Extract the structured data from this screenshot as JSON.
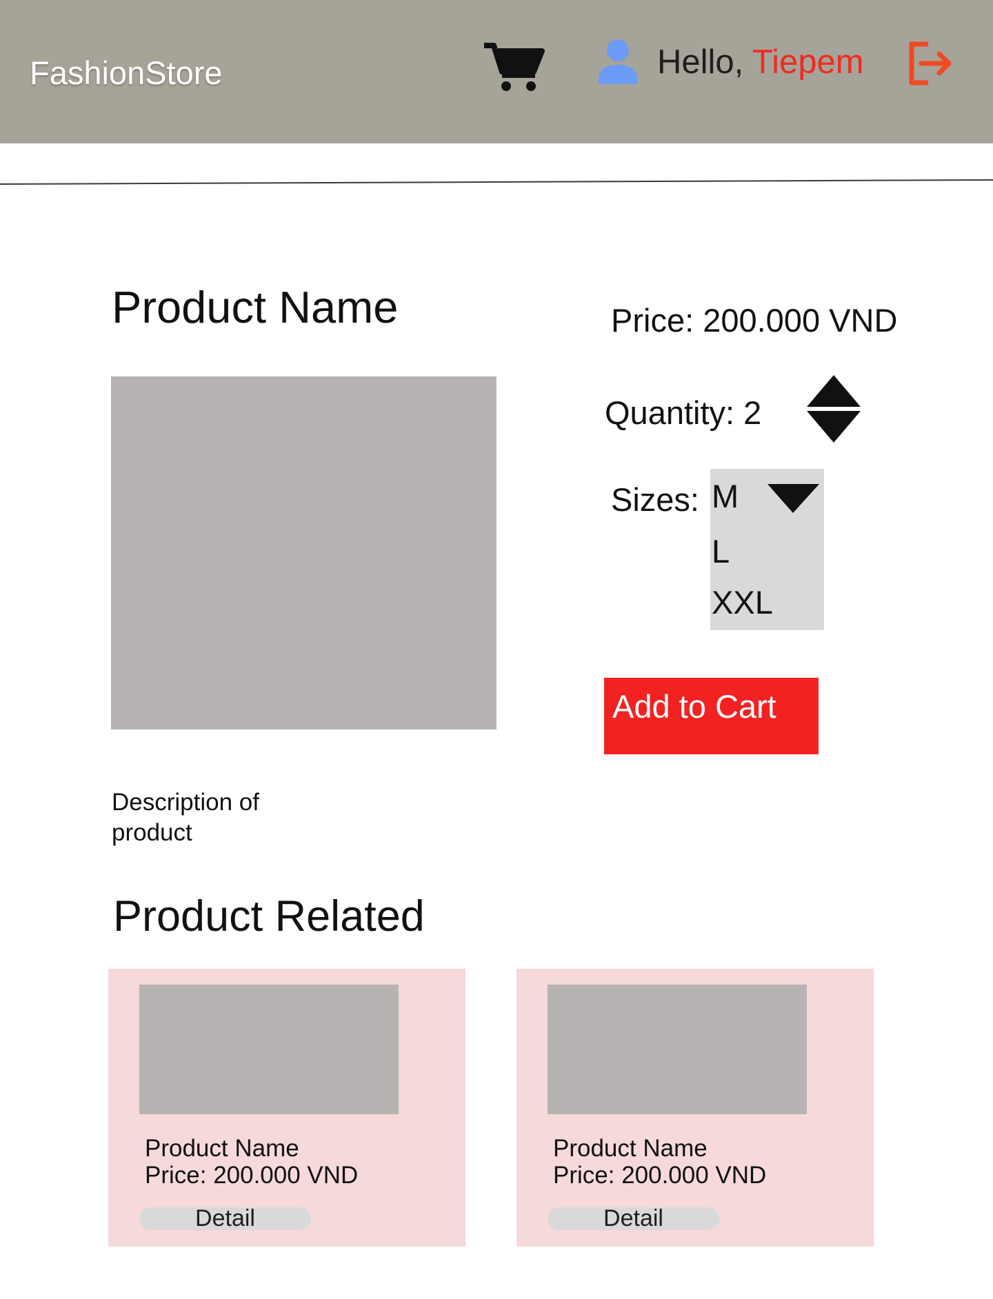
{
  "header": {
    "brand": "FashionStore",
    "greeting": "Hello, ",
    "user_name": "Tiepem",
    "colors": {
      "background": "#a6a398",
      "user_name": "#ef2b22",
      "logout_icon": "#f04a23",
      "user_icon": "#6a9cf5"
    },
    "icons": {
      "cart": "shopping-cart-icon",
      "user": "user-icon",
      "logout": "logout-icon"
    }
  },
  "product": {
    "name": "Product Name",
    "description": "Description of product",
    "price_text": "Price: 200.000 VND",
    "quantity_text": "Quantity: 2",
    "quantity": 2,
    "sizes_label": "Sizes:",
    "size_options": [
      "M",
      "L",
      "XXL"
    ],
    "selected_size": "M",
    "add_to_cart_label": "Add to Cart",
    "add_to_cart_color": "#f22222"
  },
  "related": {
    "title": "Product Related",
    "items": [
      {
        "name": "Product Name",
        "price": "Price: 200.000 VND",
        "detail_label": "Detail"
      },
      {
        "name": "Product Name",
        "price": "Price: 200.000 VND",
        "detail_label": "Detail"
      }
    ]
  }
}
